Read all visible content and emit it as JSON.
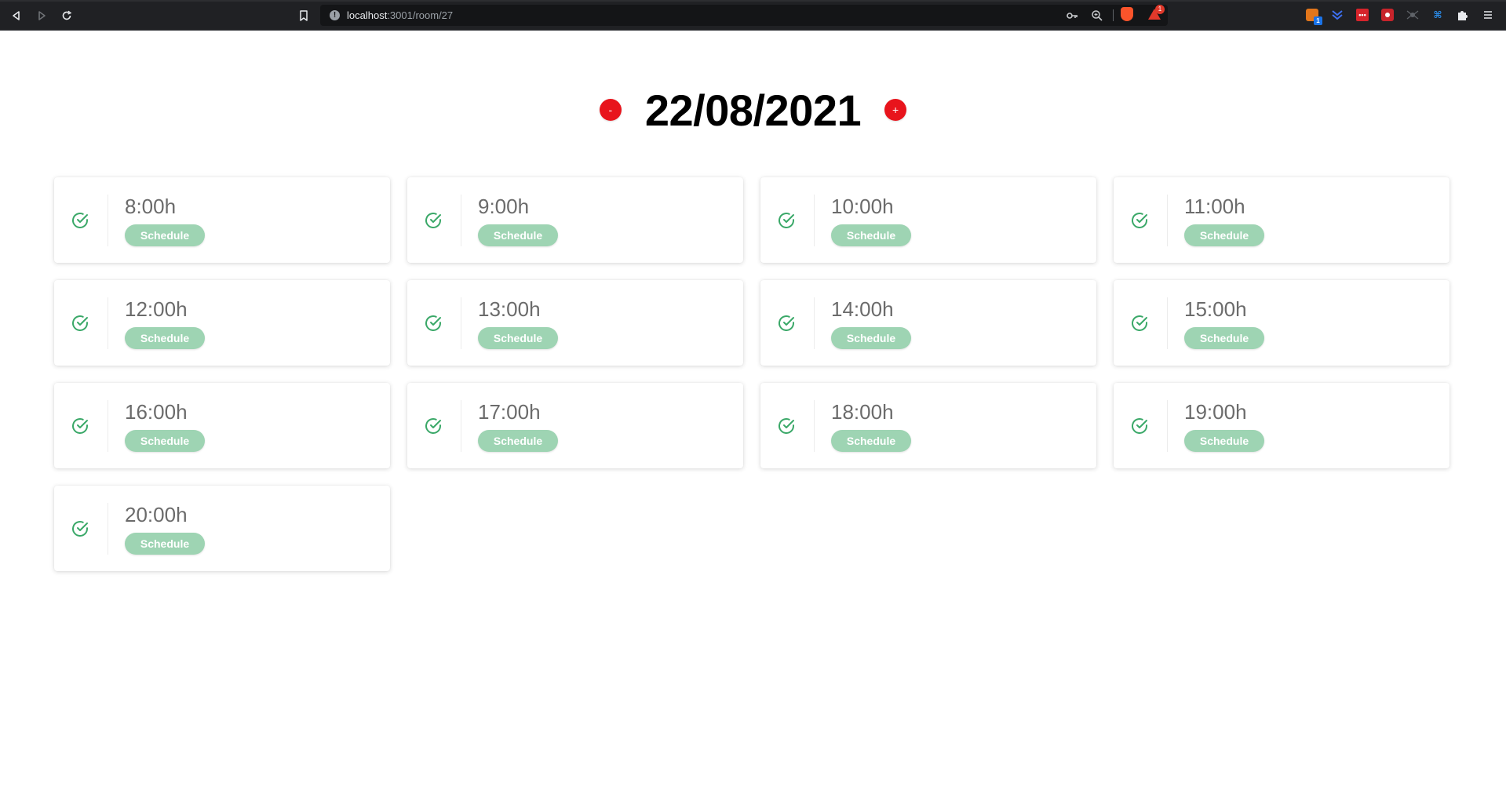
{
  "browser": {
    "url_host": "localhost",
    "url_rest": ":3001/room/27",
    "bat_badge": "1",
    "extension_badge": "1"
  },
  "page": {
    "date": "22/08/2021",
    "prev_label": "-",
    "next_label": "+"
  },
  "colors": {
    "accent_red": "#e8141c",
    "schedule_green": "#9ed4b3",
    "check_green": "#3aa868"
  },
  "slots": [
    {
      "time": "8:00h",
      "button": "Schedule",
      "icon": "check-circle-icon"
    },
    {
      "time": "9:00h",
      "button": "Schedule",
      "icon": "check-circle-icon"
    },
    {
      "time": "10:00h",
      "button": "Schedule",
      "icon": "check-circle-icon"
    },
    {
      "time": "11:00h",
      "button": "Schedule",
      "icon": "check-circle-icon"
    },
    {
      "time": "12:00h",
      "button": "Schedule",
      "icon": "check-circle-icon"
    },
    {
      "time": "13:00h",
      "button": "Schedule",
      "icon": "check-circle-icon"
    },
    {
      "time": "14:00h",
      "button": "Schedule",
      "icon": "check-circle-icon"
    },
    {
      "time": "15:00h",
      "button": "Schedule",
      "icon": "check-circle-icon"
    },
    {
      "time": "16:00h",
      "button": "Schedule",
      "icon": "check-circle-icon"
    },
    {
      "time": "17:00h",
      "button": "Schedule",
      "icon": "check-circle-icon"
    },
    {
      "time": "18:00h",
      "button": "Schedule",
      "icon": "check-circle-icon"
    },
    {
      "time": "19:00h",
      "button": "Schedule",
      "icon": "check-circle-icon"
    },
    {
      "time": "20:00h",
      "button": "Schedule",
      "icon": "check-circle-icon"
    }
  ]
}
